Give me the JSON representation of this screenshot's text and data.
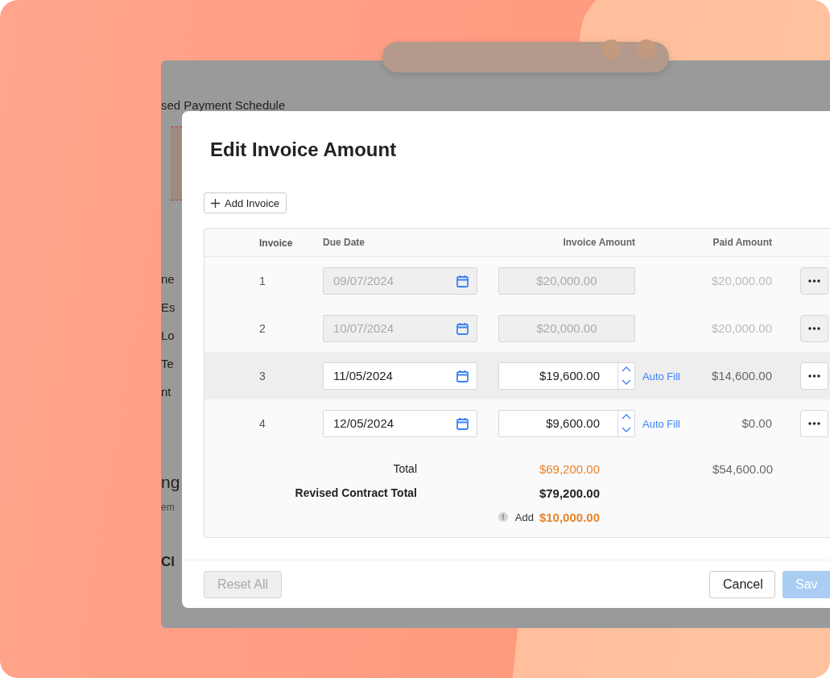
{
  "backdrop": {
    "heading": "sed Payment Schedule",
    "fragments": [
      {
        "text": "ne",
        "kind": "label"
      },
      {
        "text": "Es",
        "kind": "label"
      },
      {
        "text": "Lo",
        "kind": "label"
      },
      {
        "text": "Te",
        "kind": "label"
      },
      {
        "text": "nt",
        "kind": "label"
      },
      {
        "text": "ng",
        "kind": "heading"
      },
      {
        "text": "em",
        "kind": "note"
      },
      {
        "text": "Cl",
        "kind": "bold"
      }
    ]
  },
  "dialog": {
    "title": "Edit Invoice Amount",
    "add_button": "Add Invoice",
    "columns": [
      "Invoice",
      "Due Date",
      "Invoice Amount",
      "Paid Amount"
    ],
    "rows": [
      {
        "number": "1",
        "due_date": "09/07/2024",
        "amount": "$20,000.00",
        "paid": "$20,000.00",
        "disabled": true,
        "selected": false
      },
      {
        "number": "2",
        "due_date": "10/07/2024",
        "amount": "$20,000.00",
        "paid": "$20,000.00",
        "disabled": true,
        "selected": false
      },
      {
        "number": "3",
        "due_date": "11/05/2024",
        "amount": "$19,600.00",
        "auto_fill": "Auto Fill",
        "paid": "$14,600.00",
        "disabled": false,
        "selected": true
      },
      {
        "number": "4",
        "due_date": "12/05/2024",
        "amount": "$9,600.00",
        "auto_fill": "Auto Fill",
        "paid": "$0.00",
        "disabled": false,
        "selected": false
      }
    ],
    "totals": {
      "total_label": "Total",
      "total_amount": "$69,200.00",
      "total_paid": "$54,600.00",
      "revised_label": "Revised Contract Total",
      "revised_amount": "$79,200.00",
      "add_label": "Add",
      "add_amount": "$10,000.00"
    },
    "footer": {
      "reset_button": {
        "label": "Reset All",
        "disabled": true
      },
      "cancel_button": "Cancel",
      "save_button": {
        "label": "Sav",
        "disabled": true
      }
    }
  }
}
